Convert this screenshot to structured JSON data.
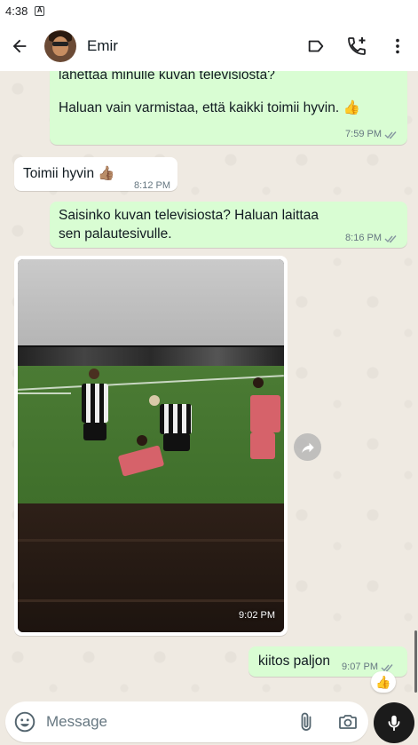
{
  "status_bar": {
    "time": "4:38",
    "notification": "A"
  },
  "header": {
    "contact_name": "Emir"
  },
  "messages": [
    {
      "id": "m1",
      "direction": "out",
      "lines": [
        "lähettää minulle kuvan televisiosta?",
        "Haluan vain varmistaa, että kaikki toimii hyvin. 👍"
      ],
      "time": "7:59 PM"
    },
    {
      "id": "m2",
      "direction": "in",
      "text": "Toimii hyvin 👍🏽",
      "time": "8:12 PM"
    },
    {
      "id": "m3",
      "direction": "out",
      "text": "Saisinko kuvan televisiosta? Haluan laittaa sen palautesivulle.",
      "time": "8:16 PM"
    },
    {
      "id": "m4",
      "direction": "in",
      "type": "image",
      "time": "9:02 PM"
    },
    {
      "id": "m5",
      "direction": "out",
      "text": "kiitos paljon",
      "time": "9:07 PM",
      "reaction": "👍"
    }
  ],
  "composer": {
    "placeholder": "Message"
  },
  "colors": {
    "outgoing_bubble": "#d9fdd3",
    "incoming_bubble": "#ffffff",
    "chat_bg": "#efeae2",
    "mic_button": "#1b1b1b"
  },
  "icons": [
    "back-arrow-icon",
    "label-icon",
    "add-call-icon",
    "more-vert-icon",
    "forward-icon",
    "emoji-icon",
    "attach-icon",
    "camera-icon",
    "mic-icon",
    "double-check-icon"
  ]
}
